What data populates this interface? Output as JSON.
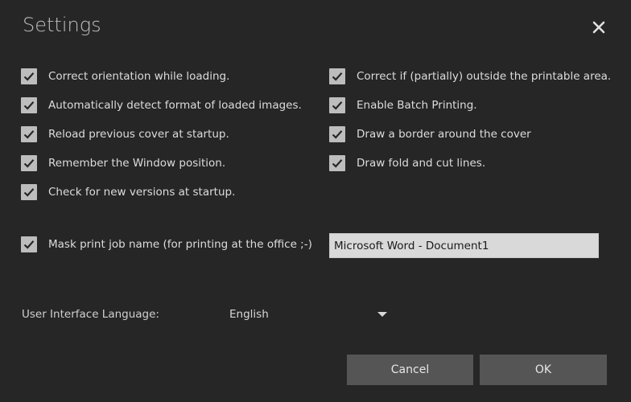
{
  "window": {
    "title": "Settings"
  },
  "options": {
    "left": [
      {
        "label": "Correct orientation while loading.",
        "checked": true
      },
      {
        "label": "Automatically detect format of loaded images.",
        "checked": true
      },
      {
        "label": "Reload previous cover at startup.",
        "checked": true
      },
      {
        "label": "Remember the Window position.",
        "checked": true
      },
      {
        "label": "Check for new versions at startup.",
        "checked": true
      }
    ],
    "right": [
      {
        "label": "Correct if (partially) outside the printable area.",
        "checked": true
      },
      {
        "label": "Enable Batch Printing.",
        "checked": true
      },
      {
        "label": "Draw a border around the cover",
        "checked": true
      },
      {
        "label": "Draw fold and cut lines.",
        "checked": true
      }
    ]
  },
  "mask": {
    "label": "Mask print job name (for printing at the office ;-)",
    "checked": true,
    "value": "Microsoft Word - Document1"
  },
  "language": {
    "label": "User Interface Language:",
    "selected": "English"
  },
  "buttons": {
    "cancel": "Cancel",
    "ok": "OK"
  },
  "icons": {
    "close": "close-icon",
    "check": "checkmark-icon",
    "dropdown": "chevron-down-icon"
  },
  "colors": {
    "background": "#262626",
    "checkbox": "#bdbdbd",
    "button": "#555555",
    "input": "#d9d9d9"
  }
}
